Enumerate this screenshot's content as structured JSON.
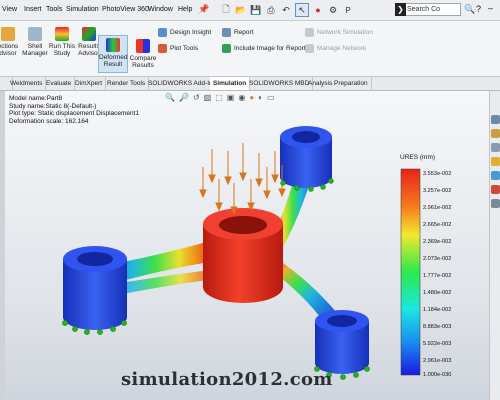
{
  "menubar": {
    "items": [
      "View",
      "Insert",
      "Tools",
      "Simulation",
      "PhotoView 360",
      "Window",
      "Help"
    ],
    "pin_icon": "pin-icon",
    "qat_icons": [
      "new-document-icon",
      "open-icon",
      "save-icon",
      "print-icon",
      "undo-icon",
      "select-arrow-icon",
      "traffic-light-icon",
      "options-gear-icon"
    ],
    "qat_trailing": "P",
    "search_placeholder": "Search Co"
  },
  "ribbon": {
    "buttons": [
      {
        "label": "ections\ndvisor",
        "icon": "sections-advisor-icon"
      },
      {
        "label": "Shell\nManager",
        "icon": "shell-manager-icon"
      },
      {
        "label": "Run This\nStudy",
        "icon": "run-study-icon"
      },
      {
        "label": "Results\nAdvisor",
        "icon": "results-advisor-icon"
      },
      {
        "label": "Deformed\nResult",
        "icon": "deformed-result-icon",
        "active": true
      },
      {
        "label": "Compare\nResults",
        "icon": "compare-results-icon"
      }
    ],
    "small": {
      "design_insight": "Design Insight",
      "plot_tools": "Plot Tools",
      "report": "Report",
      "include_image": "Include Image for Report",
      "network_simulation": "Network Simulation",
      "manage_network": "Manage Network"
    }
  },
  "tabs": [
    "Weldments",
    "Evaluate",
    "DimXpert",
    "Render Tools",
    "SOLIDWORKS Add-Ins",
    "Simulation",
    "SOLIDWORKS MBD",
    "Analysis Preparation"
  ],
  "active_tab": "Simulation",
  "viewport": {
    "info": {
      "model_name": "Model name:Part8",
      "study_name": "Study name:Static 8(-Default-)",
      "plot_type": "Plot type: Static displacement Displacement1",
      "deformation_scale": "Deformation scale: 162.164"
    },
    "hud_icons": [
      "zoom-fit-icon",
      "zoom-area-icon",
      "previous-view-icon",
      "section-view-icon",
      "view-orientation-icon",
      "display-style-icon",
      "hide-show-icon",
      "appearance-icon",
      "scene-icon",
      "monitor-icon"
    ],
    "legend": {
      "title": "URES (mm)",
      "ticks": [
        "3.553e-002",
        "3.257e-002",
        "2.961e-002",
        "2.665e-002",
        "2.369e-002",
        "2.073e-002",
        "1.777e-002",
        "1.480e-002",
        "1.184e-002",
        "8.883e-003",
        "5.922e-003",
        "2.961e-003",
        "1.000e-030"
      ],
      "colors": {
        "max": "#e8231a",
        "mid": "#2ee84a",
        "min": "#1a1ae0"
      }
    },
    "watermark": "simulation2012.com"
  },
  "colors": {
    "load_arrow": "#d9741c",
    "fixture": "#22b222",
    "deformed_red": "#e02a1a",
    "deformed_blue": "#1f3fd6"
  }
}
